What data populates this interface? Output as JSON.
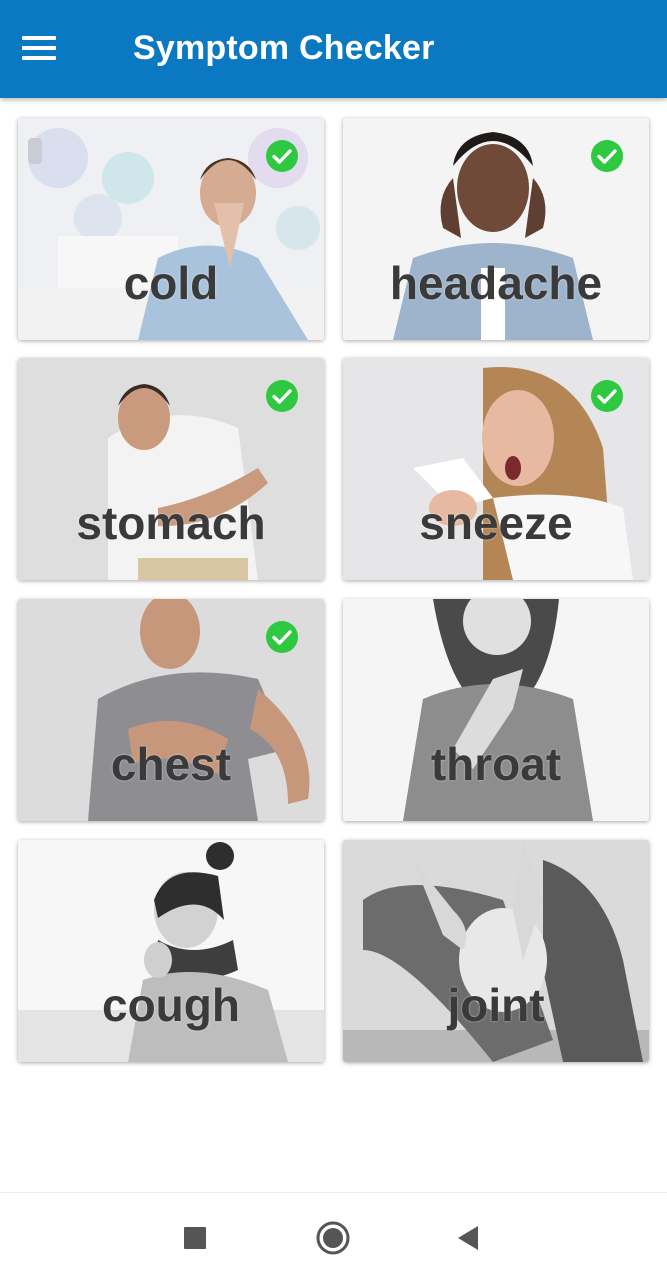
{
  "app_bar": {
    "title": "Symptom Checker",
    "menu_icon": "hamburger-menu-icon",
    "color": "#0b79c1"
  },
  "symptoms": [
    {
      "label": "cold",
      "checked": true
    },
    {
      "label": "headache",
      "checked": true
    },
    {
      "label": "stomach",
      "checked": true
    },
    {
      "label": "sneeze",
      "checked": true
    },
    {
      "label": "chest",
      "checked": true
    },
    {
      "label": "throat",
      "checked": false
    },
    {
      "label": "cough",
      "checked": false
    },
    {
      "label": "joint",
      "checked": false
    }
  ],
  "check_color": "#2ec940",
  "nav_bar": {
    "recents_icon": "square-recents-icon",
    "home_icon": "circle-home-icon",
    "back_icon": "triangle-back-icon"
  }
}
